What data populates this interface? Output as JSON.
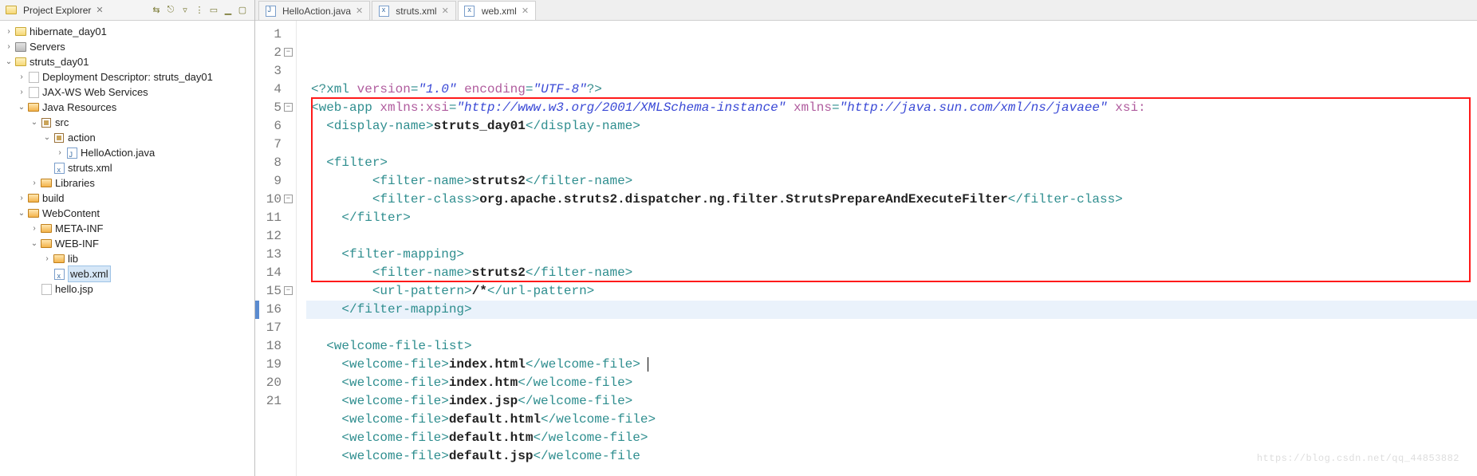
{
  "sidebar": {
    "title": "Project Explorer",
    "toolbar_icons": [
      "collapse-icon",
      "link-icon",
      "filter-icon",
      "view-menu-icon",
      "focus-icon",
      "min-icon",
      "max-icon"
    ],
    "tree": [
      {
        "d": 0,
        "exp": ">",
        "icon": "fld-y",
        "label": "hibernate_day01"
      },
      {
        "d": 0,
        "exp": ">",
        "icon": "srv",
        "label": "Servers"
      },
      {
        "d": 0,
        "exp": "v",
        "icon": "fld-y",
        "label": "struts_day01"
      },
      {
        "d": 1,
        "exp": ">",
        "icon": "fg",
        "label": "Deployment Descriptor: struts_day01"
      },
      {
        "d": 1,
        "exp": ">",
        "icon": "fg",
        "label": "JAX-WS Web Services"
      },
      {
        "d": 1,
        "exp": "v",
        "icon": "fld-o",
        "label": "Java Resources"
      },
      {
        "d": 2,
        "exp": "v",
        "icon": "pkg",
        "label": "src"
      },
      {
        "d": 3,
        "exp": "v",
        "icon": "pkg",
        "label": "action"
      },
      {
        "d": 4,
        "exp": ">",
        "icon": "fj",
        "label": "HelloAction.java"
      },
      {
        "d": 3,
        "exp": "",
        "icon": "fx",
        "label": "struts.xml"
      },
      {
        "d": 2,
        "exp": ">",
        "icon": "fld-o",
        "label": "Libraries"
      },
      {
        "d": 1,
        "exp": ">",
        "icon": "fld-o",
        "label": "build"
      },
      {
        "d": 1,
        "exp": "v",
        "icon": "fld-o",
        "label": "WebContent"
      },
      {
        "d": 2,
        "exp": ">",
        "icon": "fld-o",
        "label": "META-INF"
      },
      {
        "d": 2,
        "exp": "v",
        "icon": "fld-o",
        "label": "WEB-INF"
      },
      {
        "d": 3,
        "exp": ">",
        "icon": "fld-o",
        "label": "lib"
      },
      {
        "d": 3,
        "exp": "",
        "icon": "fx",
        "label": "web.xml",
        "selected": true
      },
      {
        "d": 2,
        "exp": "",
        "icon": "fg",
        "label": "hello.jsp"
      }
    ]
  },
  "tabs": [
    {
      "icon": "fj",
      "label": "HelloAction.java",
      "active": false
    },
    {
      "icon": "fx",
      "label": "struts.xml",
      "active": false
    },
    {
      "icon": "fx",
      "label": "web.xml",
      "active": true
    }
  ],
  "code": {
    "lines": [
      {
        "n": 1,
        "fold": "",
        "segs": [
          [
            "pi",
            "<?"
          ],
          [
            "tag",
            "xml "
          ],
          [
            "attr",
            "version"
          ],
          [
            "tag",
            "="
          ],
          [
            "str",
            "\"1.0\""
          ],
          [
            "tag",
            " "
          ],
          [
            "attr",
            "encoding"
          ],
          [
            "tag",
            "="
          ],
          [
            "str",
            "\"UTF-8\""
          ],
          [
            "pi",
            "?>"
          ]
        ]
      },
      {
        "n": 2,
        "fold": "-",
        "segs": [
          [
            "tag",
            "<web-app "
          ],
          [
            "attr",
            "xmlns:xsi"
          ],
          [
            "tag",
            "="
          ],
          [
            "str",
            "\"http://www.w3.org/2001/XMLSchema-instance\""
          ],
          [
            "tag",
            " "
          ],
          [
            "attr",
            "xmlns"
          ],
          [
            "tag",
            "="
          ],
          [
            "str",
            "\"http://java.sun.com/xml/ns/javaee\""
          ],
          [
            "tag",
            " "
          ],
          [
            "attr",
            "xsi:"
          ]
        ]
      },
      {
        "n": 3,
        "fold": "",
        "segs": [
          [
            "txt",
            "  "
          ],
          [
            "tag",
            "<display-name>"
          ],
          [
            "blk",
            "struts_day01"
          ],
          [
            "tag",
            "</display-name>"
          ]
        ]
      },
      {
        "n": 4,
        "fold": "",
        "segs": [
          [
            "txt",
            "  "
          ]
        ]
      },
      {
        "n": 5,
        "fold": "-",
        "segs": [
          [
            "txt",
            "  "
          ],
          [
            "tag",
            "<filter>"
          ]
        ]
      },
      {
        "n": 6,
        "fold": "",
        "segs": [
          [
            "txt",
            "        "
          ],
          [
            "tag",
            "<filter-name>"
          ],
          [
            "blk",
            "struts2"
          ],
          [
            "tag",
            "</filter-name>"
          ]
        ]
      },
      {
        "n": 7,
        "fold": "",
        "segs": [
          [
            "txt",
            "        "
          ],
          [
            "tag",
            "<filter-class>"
          ],
          [
            "blk",
            "org.apache.struts2.dispatcher.ng.filter.StrutsPrepareAndExecuteFilter"
          ],
          [
            "tag",
            "</filter-class>"
          ]
        ]
      },
      {
        "n": 8,
        "fold": "",
        "segs": [
          [
            "txt",
            "    "
          ],
          [
            "tag",
            "</filter>"
          ]
        ]
      },
      {
        "n": 9,
        "fold": "",
        "segs": [
          [
            "txt",
            "  "
          ]
        ]
      },
      {
        "n": 10,
        "fold": "-",
        "segs": [
          [
            "txt",
            "    "
          ],
          [
            "tag",
            "<filter-mapping>"
          ]
        ]
      },
      {
        "n": 11,
        "fold": "",
        "segs": [
          [
            "txt",
            "        "
          ],
          [
            "tag",
            "<filter-name>"
          ],
          [
            "blk",
            "struts2"
          ],
          [
            "tag",
            "</filter-name>"
          ]
        ]
      },
      {
        "n": 12,
        "fold": "",
        "segs": [
          [
            "txt",
            "        "
          ],
          [
            "tag",
            "<url-pattern>"
          ],
          [
            "blk",
            "/*"
          ],
          [
            "tag",
            "</url-pattern>"
          ]
        ]
      },
      {
        "n": 13,
        "fold": "",
        "segs": [
          [
            "txt",
            "    "
          ],
          [
            "tag",
            "</filter-mapping>"
          ]
        ]
      },
      {
        "n": 14,
        "fold": "",
        "segs": [
          [
            "txt",
            "  "
          ]
        ]
      },
      {
        "n": 15,
        "fold": "-",
        "segs": [
          [
            "txt",
            "  "
          ],
          [
            "tag",
            "<welcome-file-list>"
          ]
        ]
      },
      {
        "n": 16,
        "fold": "",
        "hl": true,
        "segs": [
          [
            "txt",
            "    "
          ],
          [
            "tag",
            "<welcome-file>"
          ],
          [
            "blk",
            "index.html"
          ],
          [
            "tag",
            "</welcome-file>"
          ],
          [
            "caret",
            ""
          ]
        ]
      },
      {
        "n": 17,
        "fold": "",
        "segs": [
          [
            "txt",
            "    "
          ],
          [
            "tag",
            "<welcome-file>"
          ],
          [
            "blk",
            "index.htm"
          ],
          [
            "tag",
            "</welcome-file>"
          ]
        ]
      },
      {
        "n": 18,
        "fold": "",
        "segs": [
          [
            "txt",
            "    "
          ],
          [
            "tag",
            "<welcome-file>"
          ],
          [
            "blk",
            "index.jsp"
          ],
          [
            "tag",
            "</welcome-file>"
          ]
        ]
      },
      {
        "n": 19,
        "fold": "",
        "segs": [
          [
            "txt",
            "    "
          ],
          [
            "tag",
            "<welcome-file>"
          ],
          [
            "blk",
            "default.html"
          ],
          [
            "tag",
            "</welcome-file>"
          ]
        ]
      },
      {
        "n": 20,
        "fold": "",
        "segs": [
          [
            "txt",
            "    "
          ],
          [
            "tag",
            "<welcome-file>"
          ],
          [
            "blk",
            "default.htm"
          ],
          [
            "tag",
            "</welcome-file>"
          ]
        ]
      },
      {
        "n": 21,
        "fold": "",
        "segs": [
          [
            "txt",
            "    "
          ],
          [
            "tag",
            "<welcome-file>"
          ],
          [
            "blk",
            "default.jsp"
          ],
          [
            "tag",
            "</welcome-file"
          ]
        ]
      }
    ],
    "redbox": {
      "top_line": 5,
      "bottom_line": 14
    },
    "watermark": "https://blog.csdn.net/qq_44853882"
  }
}
